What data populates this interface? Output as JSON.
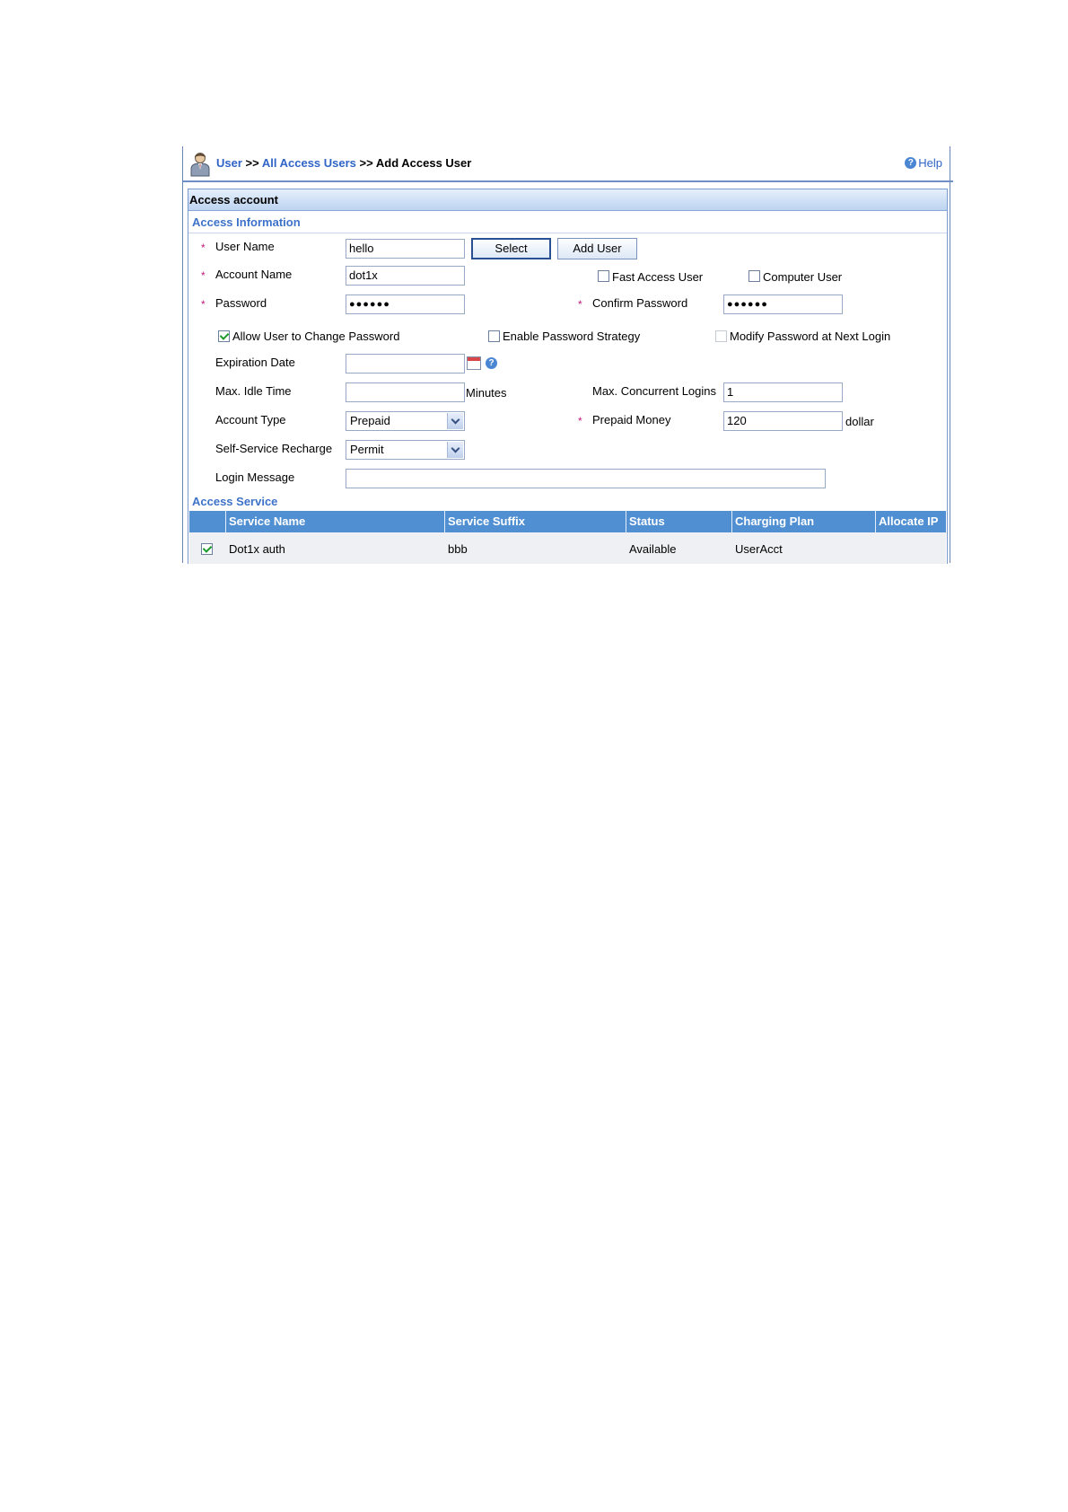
{
  "breadcrumb": {
    "user": "User",
    "sep1": ">>",
    "all_access_users": "All Access Users",
    "sep2": ">>",
    "current": "Add Access User"
  },
  "help_label": "Help",
  "panel_title": "Access account",
  "access_information": {
    "title": "Access Information",
    "required_mark": "*",
    "user_name": {
      "label": "User Name",
      "value": "hello"
    },
    "select_button": "Select",
    "add_user_button": "Add User",
    "account_name": {
      "label": "Account Name",
      "value": "dot1x"
    },
    "fast_access_user": {
      "label": "Fast Access User",
      "checked": false
    },
    "computer_user": {
      "label": "Computer User",
      "checked": false
    },
    "password": {
      "label": "Password",
      "value": "●●●●●●"
    },
    "confirm_password": {
      "label": "Confirm Password",
      "value": "●●●●●●"
    },
    "allow_change_password": {
      "label": "Allow User to Change Password",
      "checked": true
    },
    "enable_password_strategy": {
      "label": "Enable Password Strategy",
      "checked": false
    },
    "modify_password_next_login": {
      "label": "Modify Password at Next Login",
      "checked": false,
      "disabled": true
    },
    "expiration_date": {
      "label": "Expiration Date",
      "value": ""
    },
    "max_idle_time": {
      "label": "Max. Idle Time",
      "value": "",
      "unit": "Minutes"
    },
    "max_concurrent_logins": {
      "label": "Max. Concurrent Logins",
      "value": "1"
    },
    "account_type": {
      "label": "Account Type",
      "value": "Prepaid"
    },
    "prepaid_money": {
      "label": "Prepaid Money",
      "value": "120",
      "unit": "dollar"
    },
    "self_service_recharge": {
      "label": "Self-Service Recharge",
      "value": "Permit"
    },
    "login_message": {
      "label": "Login Message",
      "value": ""
    }
  },
  "access_service": {
    "title": "Access Service",
    "columns": [
      "Service Name",
      "Service Suffix",
      "Status",
      "Charging Plan",
      "Allocate IP"
    ],
    "rows": [
      {
        "checked": true,
        "service_name": "Dot1x auth",
        "service_suffix": "bbb",
        "status": "Available",
        "charging_plan": "UserAcct",
        "allocate_ip": ""
      }
    ]
  },
  "colors": {
    "link": "#2f64c6",
    "section_title": "#3d72c9",
    "required_mark": "#c0197c",
    "table_header": "#4f8fd2"
  }
}
